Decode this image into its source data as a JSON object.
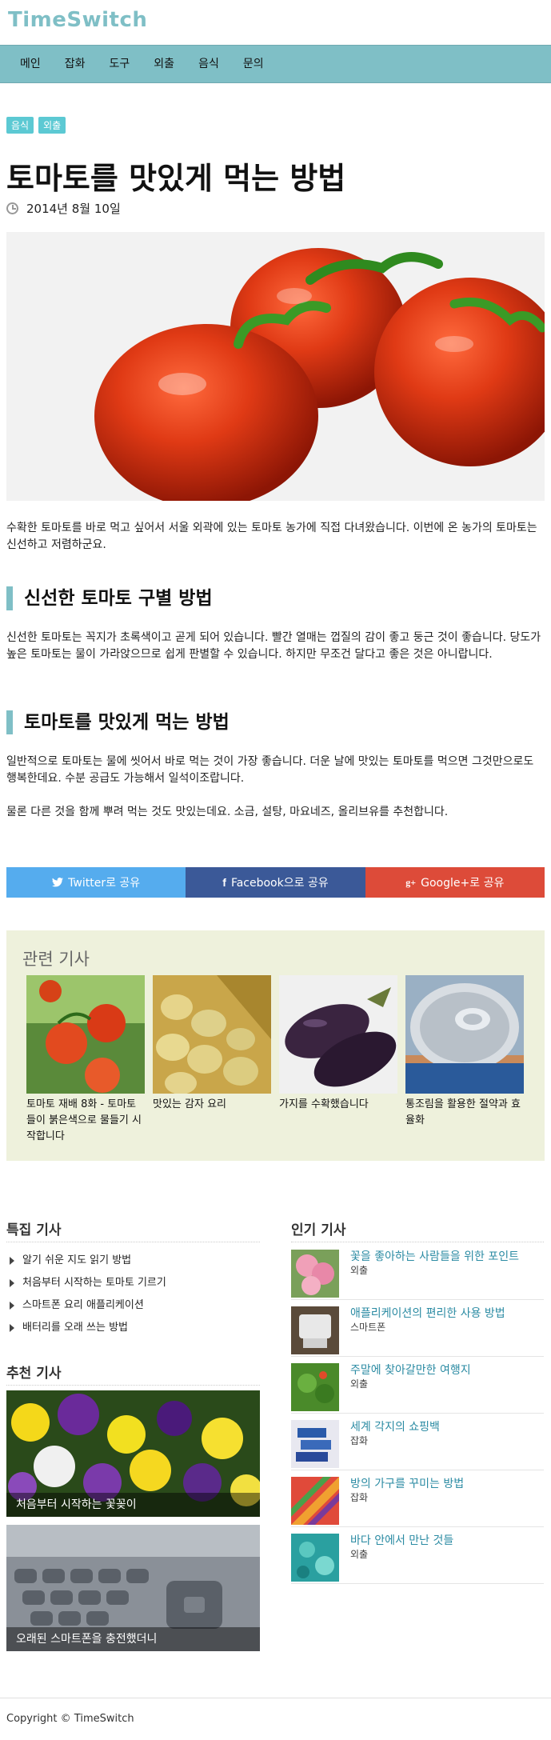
{
  "site": {
    "logo": "TimeSwitch"
  },
  "nav": [
    "메인",
    "잡화",
    "도구",
    "외출",
    "음식",
    "문의"
  ],
  "article": {
    "tags": [
      "음식",
      "외출"
    ],
    "title": "토마토를 맛있게 먹는 방법",
    "date": "2014년 8월 10일",
    "intro": "수확한 토마토를 바로 먹고 싶어서 서울 외곽에 있는 토마토 농가에 직접 다녀왔습니다. 이번에 온 농가의 토마토는 신선하고 저렴하군요.",
    "section1_heading": "신선한 토마토 구별 방법",
    "section1_text": "신선한 토마토는 꼭지가 초록색이고 곧게 되어 있습니다. 빨간 열매는 껍질의 감이 좋고 둥근 것이 좋습니다. 당도가 높은 토마토는 물이 가라앉으므로 쉽게 판별할 수 있습니다. 하지만 무조건 달다고 좋은 것은 아니랍니다.",
    "section2_heading": "토마토를 맛있게 먹는 방법",
    "section2_text1": "일반적으로 토마토는 물에 씻어서 바로 먹는 것이 가장 좋습니다. 더운 날에 맛있는 토마토를 먹으면 그것만으로도 행복한데요. 수분 공급도 가능해서 일석이조랍니다.",
    "section2_text2": "물론 다른 것을 함께 뿌려 먹는 것도 맛있는데요. 소금, 설탕, 마요네즈, 올리브유를 추천합니다."
  },
  "share": {
    "twitter": "Twitter로 공유",
    "facebook": "Facebook으로 공유",
    "google": "Google+로 공유",
    "colors": {
      "twitter": "#55acee",
      "facebook": "#3b5998",
      "google": "#dd4b39"
    }
  },
  "related": {
    "title": "관련 기사",
    "items": [
      {
        "caption": "토마토 재배 8화 - 토마토들이 붉은색으로 물들기 시작합니다"
      },
      {
        "caption": "맛있는 감자 요리"
      },
      {
        "caption": "가지를 수확했습니다"
      },
      {
        "caption": "통조림을 활용한 절약과 효율화"
      }
    ]
  },
  "feature": {
    "title": "특집 기사",
    "items": [
      "알기 쉬운 지도 읽기 방법",
      "처음부터 시작하는 토마토 기르기",
      "스마트폰 요리 애플리케이션",
      "배터리를 오래 쓰는 방법"
    ]
  },
  "recommended": {
    "title": "추천 기사",
    "items": [
      {
        "caption": "처음부터 시작하는 꽃꽂이"
      },
      {
        "caption": "오래된 스마트폰을 충전했더니"
      }
    ]
  },
  "popular": {
    "title": "인기 기사",
    "items": [
      {
        "title": "꽃을 좋아하는 사람들을 위한 포인트",
        "category": "외출"
      },
      {
        "title": "애플리케이션의 편리한 사용 방법",
        "category": "스마트폰"
      },
      {
        "title": "주말에 찾아갈만한 여행지",
        "category": "외출"
      },
      {
        "title": "세계 각지의 쇼핑백",
        "category": "잡화"
      },
      {
        "title": "방의 가구를 꾸미는 방법",
        "category": "잡화"
      },
      {
        "title": "바다 안에서 만난 것들",
        "category": "외출"
      }
    ]
  },
  "footer": {
    "copyright": "Copyright © TimeSwitch"
  }
}
